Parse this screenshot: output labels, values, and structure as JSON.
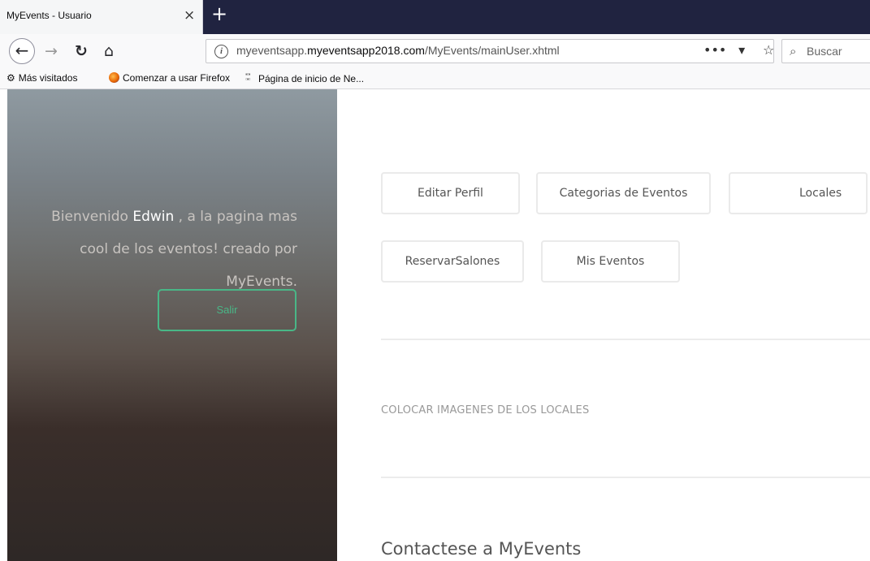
{
  "browser": {
    "tab_title": "MyEvents - Usuario",
    "tab_close": "×",
    "new_tab": "+",
    "url_prefix": "myeventsapp.",
    "url_domain": "myeventsapp2018.com",
    "url_path": "/MyEvents/mainUser.xhtml",
    "search_placeholder": "Buscar",
    "bookmarks": [
      {
        "label": "Más visitados",
        "icon": "gear-icon"
      },
      {
        "label": "Comenzar a usar Firefox",
        "icon": "firefox-icon"
      },
      {
        "label": "Página de inicio de Ne...",
        "icon": "grid-icon"
      }
    ]
  },
  "sidebar": {
    "welcome_before": "Bienvenido ",
    "user_name": "Edwin",
    "welcome_after": " , a la pagina mas cool de los eventos! creado por MyEvents.",
    "logout_label": "Salir"
  },
  "main": {
    "buttons": [
      "Editar Perfil",
      "Categorias de Eventos",
      "Locales",
      "ReservarSalones",
      "Mis Eventos"
    ],
    "section_label": "COLOCAR IMAGENES DE LOS LOCALES",
    "contact_heading": "Contactese a MyEvents"
  },
  "colors": {
    "accent": "#49b787",
    "tabbar": "#202340"
  }
}
